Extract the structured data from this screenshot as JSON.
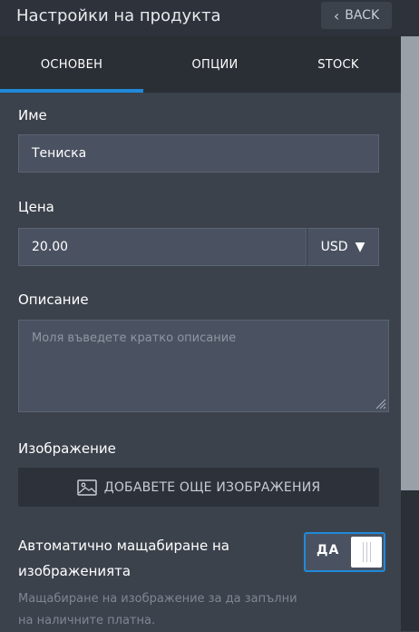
{
  "header": {
    "title": "Настройки на продукта",
    "back_label": "BACK"
  },
  "tabs": [
    {
      "label": "ОСНОВЕН",
      "active": true
    },
    {
      "label": "ОПЦИИ",
      "active": false
    },
    {
      "label": "STOCK",
      "active": false
    }
  ],
  "form": {
    "name": {
      "label": "Име",
      "value": "Тениска"
    },
    "price": {
      "label": "Цена",
      "value": "20.00",
      "currency": "USD"
    },
    "description": {
      "label": "Описание",
      "placeholder": "Моля въведете кратко описание"
    },
    "image": {
      "label": "Изображение",
      "add_label": "ДОБАВЕТЕ ОЩЕ ИЗОБРАЖЕНИЯ"
    },
    "auto_scale": {
      "title": "Автоматично мащабиране на изображенията",
      "description": "Мащабиране на изображение за да запълни на наличните платна.",
      "toggle_label": "ДА",
      "enabled": true
    }
  },
  "colors": {
    "accent": "#1f8ad8",
    "background": "#3c424c",
    "header": "#2e333b",
    "input": "#4a5261"
  }
}
